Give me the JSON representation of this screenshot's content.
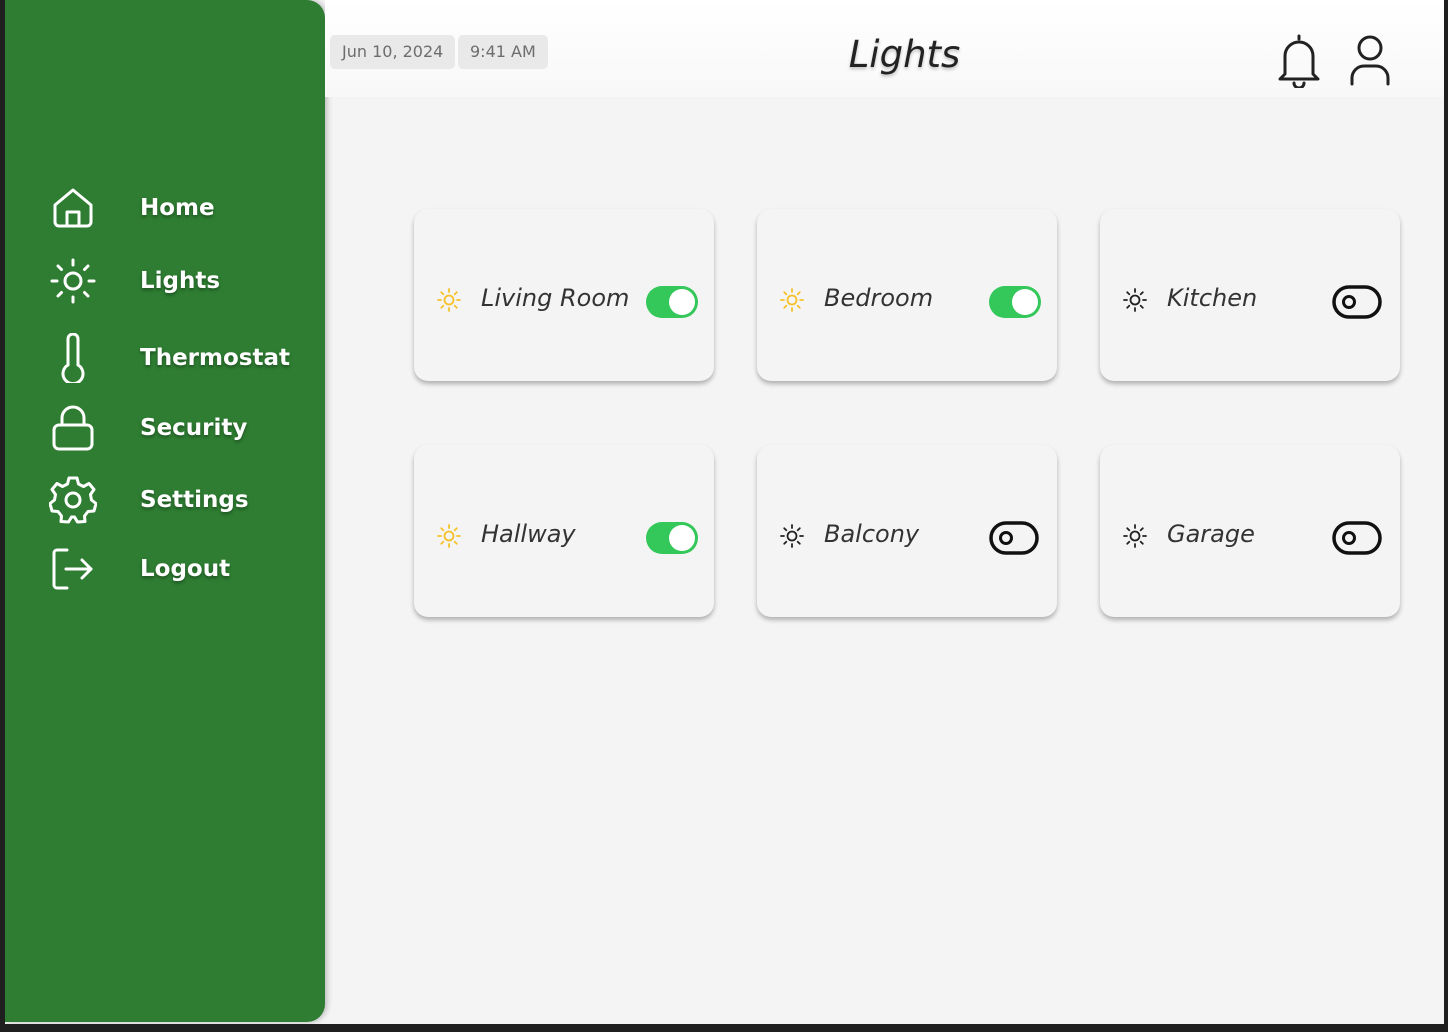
{
  "header": {
    "date": "Jun 10, 2024",
    "time": "9:41 AM",
    "title": "Lights",
    "icons": [
      "bell-icon",
      "user-icon"
    ]
  },
  "sidebar": {
    "background": "#2e7d32",
    "items": [
      {
        "label": "Home",
        "icon": "home-icon"
      },
      {
        "label": "Lights",
        "icon": "sun-icon"
      },
      {
        "label": "Thermostat",
        "icon": "thermometer-icon"
      },
      {
        "label": "Security",
        "icon": "lock-icon"
      },
      {
        "label": "Settings",
        "icon": "gear-icon"
      },
      {
        "label": "Logout",
        "icon": "logout-icon"
      }
    ]
  },
  "lights": [
    {
      "room": "Living Room",
      "on": true
    },
    {
      "room": "Bedroom",
      "on": true
    },
    {
      "room": "Kitchen",
      "on": false
    },
    {
      "room": "Hallway",
      "on": true
    },
    {
      "room": "Balcony",
      "on": false
    },
    {
      "room": "Garage",
      "on": false
    }
  ],
  "colors": {
    "toggle_on": "#34c759",
    "sun_on": "#f6c12a",
    "sun_off": "#222222"
  }
}
